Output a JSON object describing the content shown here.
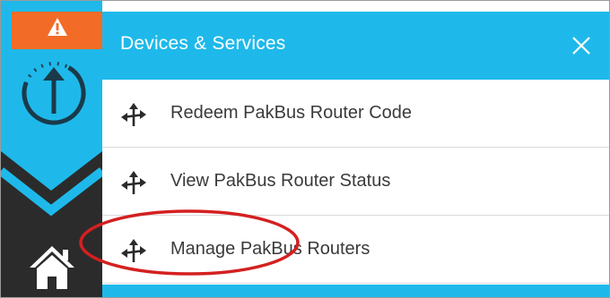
{
  "rail": {
    "alert_icon": "warning-icon",
    "sync_icon": "sync-arrow-icon",
    "collapse_icon": "chevron-down-icon",
    "home_icon": "home-icon"
  },
  "panel": {
    "title": "Devices & Services",
    "close_icon": "close-icon",
    "items": [
      {
        "label": "Redeem PakBus Router Code",
        "icon": "router-arrows-icon"
      },
      {
        "label": "View PakBus Router Status",
        "icon": "router-arrows-icon"
      },
      {
        "label": "Manage PakBus Routers",
        "icon": "router-arrows-icon"
      }
    ]
  },
  "colors": {
    "accent": "#1eb9ea",
    "alert": "#f36c27",
    "dark": "#2b2b2b",
    "highlight": "#d42020"
  }
}
